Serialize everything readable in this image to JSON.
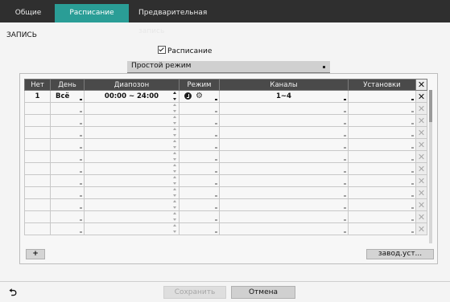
{
  "tabs": [
    {
      "label": "Общие"
    },
    {
      "label": "Расписание"
    },
    {
      "label": "Предварительная запись"
    }
  ],
  "section_title": "ЗАПИСЬ",
  "schedule_checkbox": {
    "label": "Расписание",
    "checked": true
  },
  "mode_select": {
    "value": "Простой режим"
  },
  "table": {
    "headers": [
      "Нет",
      "День",
      "Диапозон",
      "Режим",
      "Каналы",
      "Установки"
    ],
    "rows": [
      {
        "no": "1",
        "day": "Всё",
        "range": "00:00 ~ 24:00",
        "mode_icons": [
          "record-icon",
          "motion-icon"
        ],
        "channels": "1~4",
        "settings": ""
      }
    ],
    "empty_rows": 11
  },
  "buttons": {
    "add": "+",
    "factory": "завод.уст...",
    "save": "Сохранить",
    "cancel": "Отмена"
  },
  "colors": {
    "tab_active": "#2a9d96",
    "tab_bar": "#2f2f2f",
    "header_bg": "#4a4a4a"
  }
}
